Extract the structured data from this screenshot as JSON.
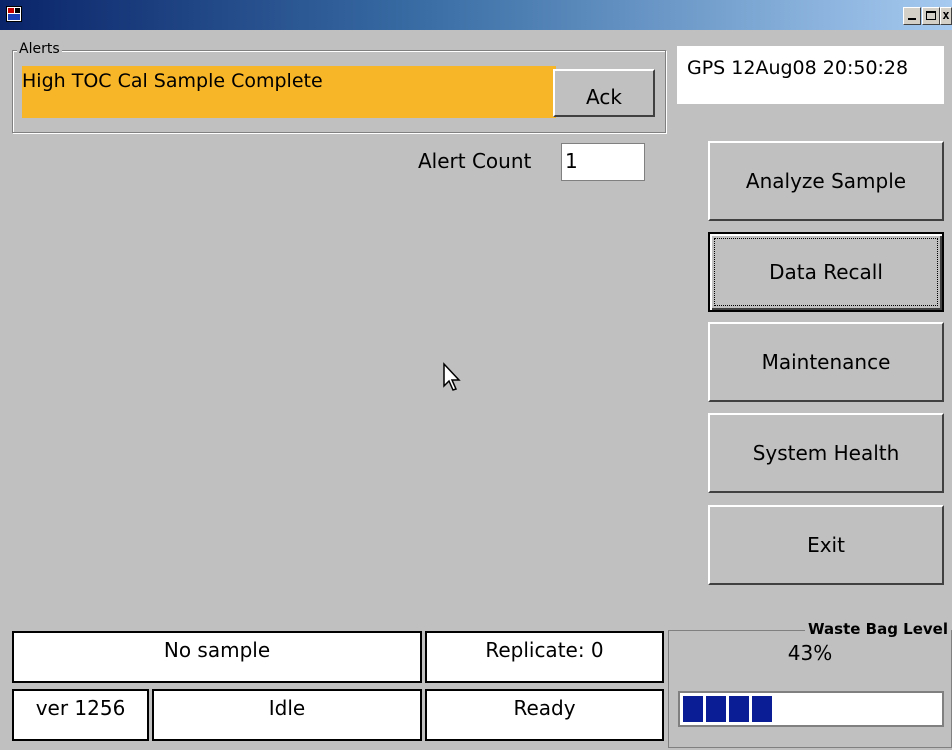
{
  "window": {
    "buttons": [
      "_",
      "□",
      "x"
    ]
  },
  "alerts": {
    "legend": "Alerts",
    "message": "High TOC Cal Sample Complete",
    "ack_label": "Ack",
    "count_label": "Alert Count",
    "count_value": "1"
  },
  "gps": {
    "text": "GPS 12Aug08 20:50:28"
  },
  "side_buttons": [
    {
      "label": "Analyze Sample"
    },
    {
      "label": "Data Recall"
    },
    {
      "label": "Maintenance"
    },
    {
      "label": "System Health"
    },
    {
      "label": "Exit"
    }
  ],
  "status": {
    "sample": "No sample",
    "replicate": "Replicate: 0",
    "version": "ver 1256",
    "state": "Idle",
    "ready": "Ready"
  },
  "waste_bag": {
    "legend": "Waste Bag Level",
    "percent_text": "43%",
    "level_fraction": 0.43,
    "fill_color": "#0a1d94"
  },
  "colors": {
    "alert_banner": "#f7b528",
    "background": "#c0c0c0"
  }
}
